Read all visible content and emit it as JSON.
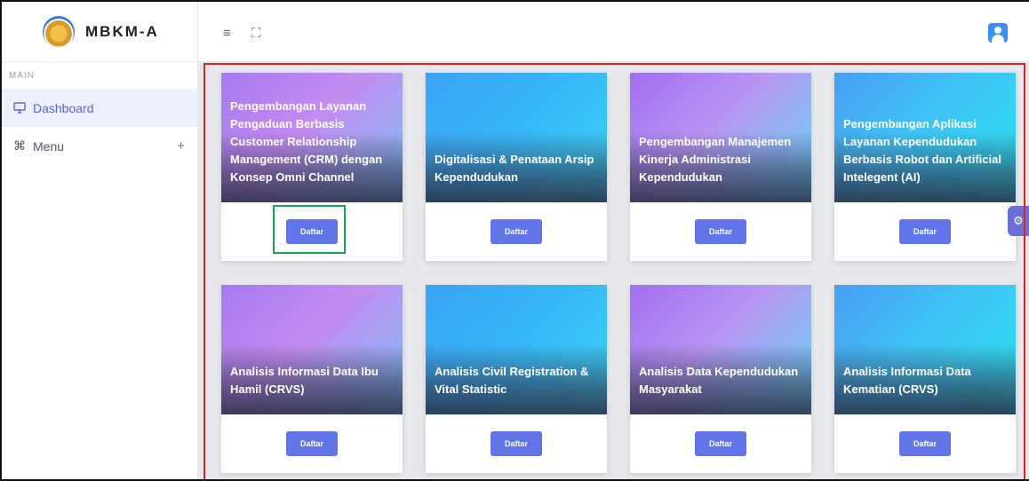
{
  "brand": {
    "name": "MBKM-A"
  },
  "sidebar": {
    "section_label": "MAIN",
    "items": [
      {
        "label": "Dashboard",
        "icon": "monitor-icon",
        "active": true
      },
      {
        "label": "Menu",
        "icon": "command-icon",
        "expand": "+"
      }
    ]
  },
  "topbar": {
    "menu_icon": "≡",
    "fullscreen_icon": "⛶"
  },
  "cards": [
    {
      "title": "Pengembangan Layanan Pengaduan Berbasis Customer Relationship Management (CRM) dengan Konsep Omni Channel",
      "button": "Daftar"
    },
    {
      "title": "Digitalisasi & Penataan Arsip Kependudukan",
      "button": "Daftar"
    },
    {
      "title": "Pengembangan Manajemen Kinerja Administrasi Kependudukan",
      "button": "Daftar"
    },
    {
      "title": "Pengembangan Aplikasi Layanan Kependudukan Berbasis Robot dan Artificial Intelegent (AI)",
      "button": "Daftar"
    },
    {
      "title": "Analisis Informasi Data Ibu Hamil (CRVS)",
      "button": "Daftar"
    },
    {
      "title": "Analisis Civil Registration & Vital Statistic",
      "button": "Daftar"
    },
    {
      "title": "Analisis Data Kependudukan Masyarakat",
      "button": "Daftar"
    },
    {
      "title": "Analisis Informasi Data Kematian (CRVS)",
      "button": "Daftar"
    }
  ],
  "colors": {
    "accent": "#6174e8",
    "highlight_red": "#e02020",
    "highlight_green": "#1aa34a"
  }
}
